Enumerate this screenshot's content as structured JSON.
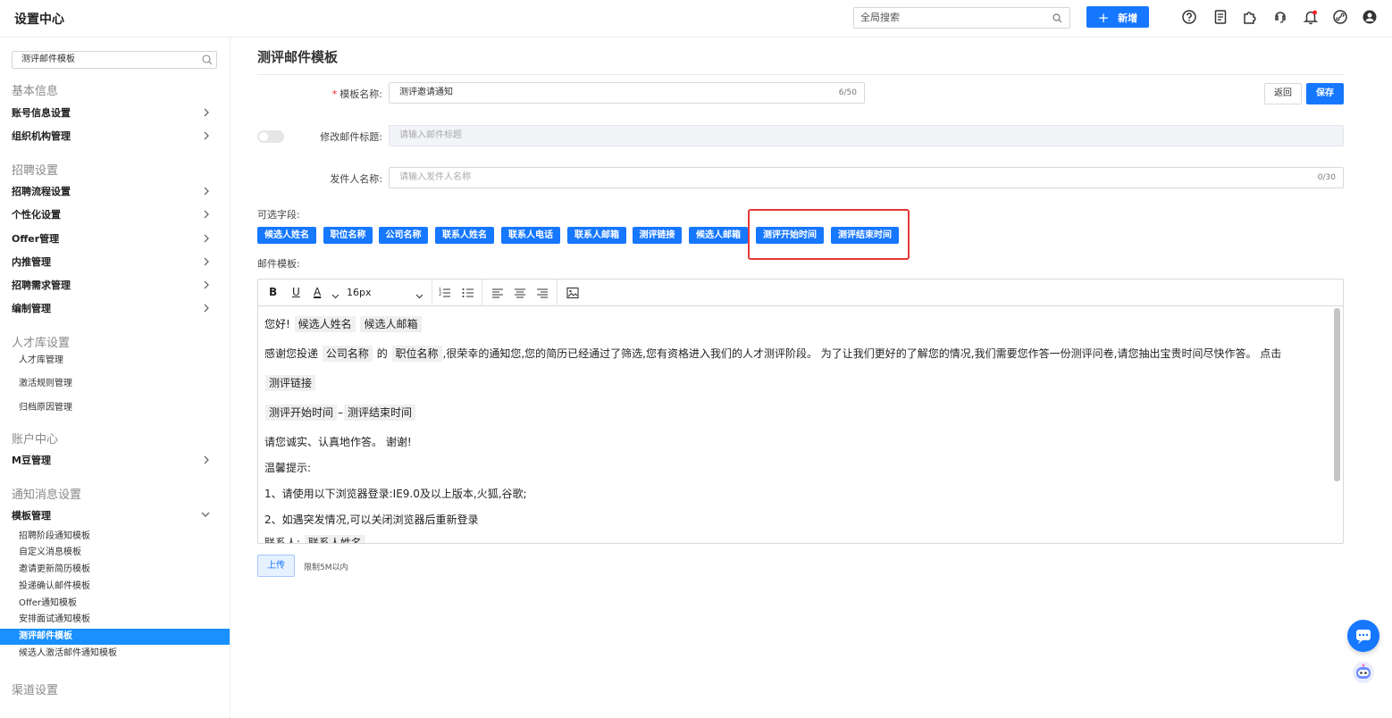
{
  "app": {
    "title": "设置中心"
  },
  "header": {
    "search_placeholder": "全局搜索",
    "new_label": "新增"
  },
  "sidebar": {
    "search_value": "测评邮件模板",
    "sections": {
      "basic": "基本信息",
      "recruit": "招聘设置",
      "talent": "人才库设置",
      "account": "账户中心",
      "notify": "通知消息设置",
      "cutoff": "渠道设置"
    },
    "items": {
      "account_info": "账号信息设置",
      "org": "组织机构管理",
      "flow": "招聘流程设置",
      "personal": "个性化设置",
      "offer": "Offer管理",
      "referral": "内推管理",
      "demand": "招聘需求管理",
      "headcount": "编制管理",
      "talent_pool": "人才库管理",
      "activation_rules": "激活规则管理",
      "archive_reasons": "归档原因管理",
      "mdou": "M豆管理",
      "template_mgmt": "模板管理"
    },
    "template_subs": [
      "招聘阶段通知模板",
      "自定义消息模板",
      "邀请更新简历模板",
      "投递确认邮件模板",
      "Offer通知模板",
      "安排面试通知模板",
      "测评邮件模板",
      "候选人激活邮件通知模板"
    ]
  },
  "main": {
    "page_title": "测评邮件模板",
    "form": {
      "name_label": "模板名称:",
      "name_value": "测评邀请通知",
      "name_count": "6/50",
      "subject_label": "修改邮件标题:",
      "subject_placeholder": "请输入邮件标题",
      "sender_label": "发件人名称:",
      "sender_placeholder": "请输入发件人名称",
      "sender_count": "0/30"
    },
    "buttons": {
      "back": "返回",
      "save": "保存"
    },
    "fields_label": "可选字段:",
    "fields": [
      "候选人姓名",
      "职位名称",
      "公司名称",
      "联系人姓名",
      "联系人电话",
      "联系人邮箱",
      "测评链接",
      "候选人邮箱",
      "测评开始时间",
      "测评结束时间"
    ],
    "template_label": "邮件模板:",
    "toolbar": {
      "font_size": "16px"
    },
    "body": {
      "greeting": "您好!",
      "chip_candidate_name": "候选人姓名",
      "chip_candidate_email": "候选人邮箱",
      "thanks_pre": "感谢您投递",
      "chip_company": "公司名称",
      "of": "的",
      "chip_position": "职位名称",
      "thanks_post": ",很荣幸的通知您,您的简历已经通过了筛选,您有资格进入我们的人才测评阶段。 为了让我们更好的了解您的情况,我们需要您作答一份测评问卷,请您抽出宝贵时间尽快作答。 点击",
      "chip_link": "测评链接",
      "chip_start": "测评开始时间",
      "dash": "–",
      "chip_end": "测评结束时间",
      "honest": "请您诚实、认真地作答。 谢谢!",
      "tips": "温馨提示:",
      "tip1": "1、请使用以下浏览器登录:IE9.0及以上版本,火狐,谷歌;",
      "tip2": "2、如遇突发情况,可以关闭浏览器后重新登录",
      "contact": "联系人:",
      "chip_contact": "联系人姓名"
    },
    "upload": {
      "label": "上传",
      "hint": "限制5M以内"
    }
  },
  "colors": {
    "primary": "#1677ff",
    "highlight": "#e53935",
    "active_menu": "#1890ff"
  }
}
